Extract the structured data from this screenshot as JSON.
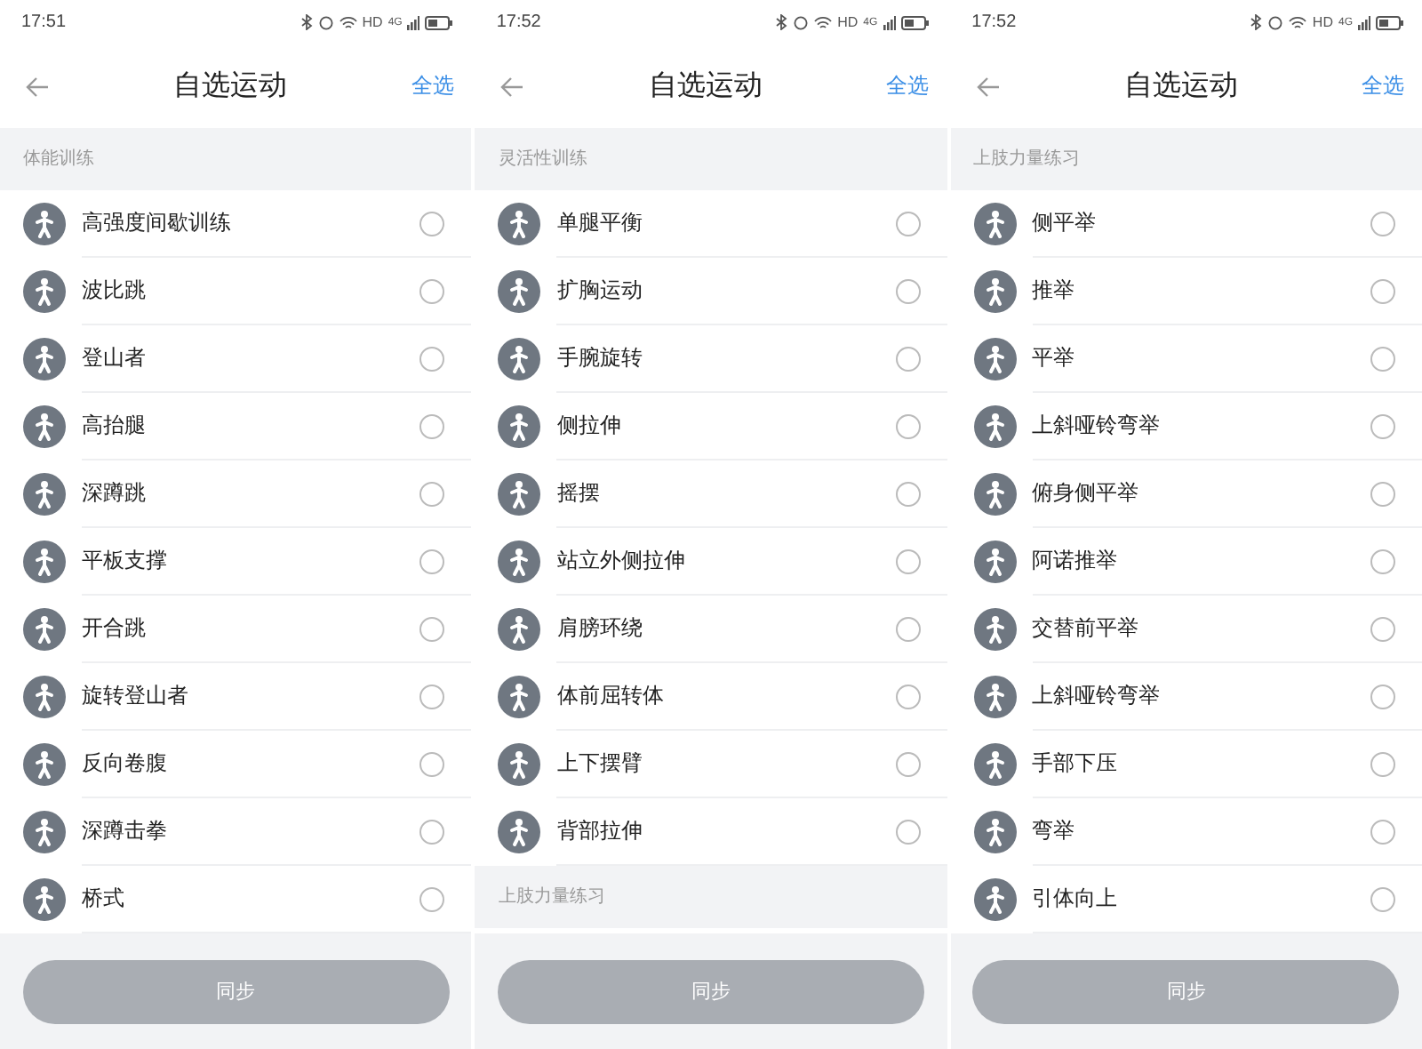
{
  "screens": [
    {
      "status_bar": {
        "time": "17:51",
        "network": "HD",
        "signal": "4G"
      },
      "title": "自选运动",
      "select_all": "全选",
      "sections": [
        {
          "title": "体能训练",
          "items": [
            {
              "label": "高强度间歇训练",
              "selected": false
            },
            {
              "label": "波比跳",
              "selected": false
            },
            {
              "label": "登山者",
              "selected": false
            },
            {
              "label": "高抬腿",
              "selected": false
            },
            {
              "label": "深蹲跳",
              "selected": false
            },
            {
              "label": "平板支撑",
              "selected": false
            },
            {
              "label": "开合跳",
              "selected": false
            },
            {
              "label": "旋转登山者",
              "selected": false
            },
            {
              "label": "反向卷腹",
              "selected": false
            },
            {
              "label": "深蹲击拳",
              "selected": false
            },
            {
              "label": "桥式",
              "selected": false
            }
          ]
        }
      ],
      "button": {
        "label": "同步",
        "disabled": true
      }
    },
    {
      "status_bar": {
        "time": "17:52",
        "network": "HD",
        "signal": "4G"
      },
      "title": "自选运动",
      "select_all": "全选",
      "sections": [
        {
          "title": "灵活性训练",
          "items": [
            {
              "label": "单腿平衡",
              "selected": false
            },
            {
              "label": "扩胸运动",
              "selected": false
            },
            {
              "label": "手腕旋转",
              "selected": false
            },
            {
              "label": "侧拉伸",
              "selected": false
            },
            {
              "label": "摇摆",
              "selected": false
            },
            {
              "label": "站立外侧拉伸",
              "selected": false
            },
            {
              "label": "肩膀环绕",
              "selected": false
            },
            {
              "label": "体前屈转体",
              "selected": false
            },
            {
              "label": "上下摆臂",
              "selected": false
            },
            {
              "label": "背部拉伸",
              "selected": false
            }
          ]
        },
        {
          "title": "上肢力量练习"
        }
      ],
      "button": {
        "label": "同步",
        "disabled": true
      }
    },
    {
      "status_bar": {
        "time": "17:52",
        "network": "HD",
        "signal": "4G"
      },
      "title": "自选运动",
      "select_all": "全选",
      "sections": [
        {
          "title": "上肢力量练习",
          "items": [
            {
              "label": "侧平举",
              "selected": false
            },
            {
              "label": "推举",
              "selected": false
            },
            {
              "label": "平举",
              "selected": false
            },
            {
              "label": "上斜哑铃弯举",
              "selected": false
            },
            {
              "label": "俯身侧平举",
              "selected": false
            },
            {
              "label": "阿诺推举",
              "selected": false
            },
            {
              "label": "交替前平举",
              "selected": false
            },
            {
              "label": "上斜哑铃弯举",
              "selected": false
            },
            {
              "label": "手部下压",
              "selected": false
            },
            {
              "label": "弯举",
              "selected": false
            },
            {
              "label": "引体向上",
              "selected": false
            }
          ]
        }
      ],
      "button": {
        "label": "同步",
        "disabled": true
      }
    }
  ]
}
